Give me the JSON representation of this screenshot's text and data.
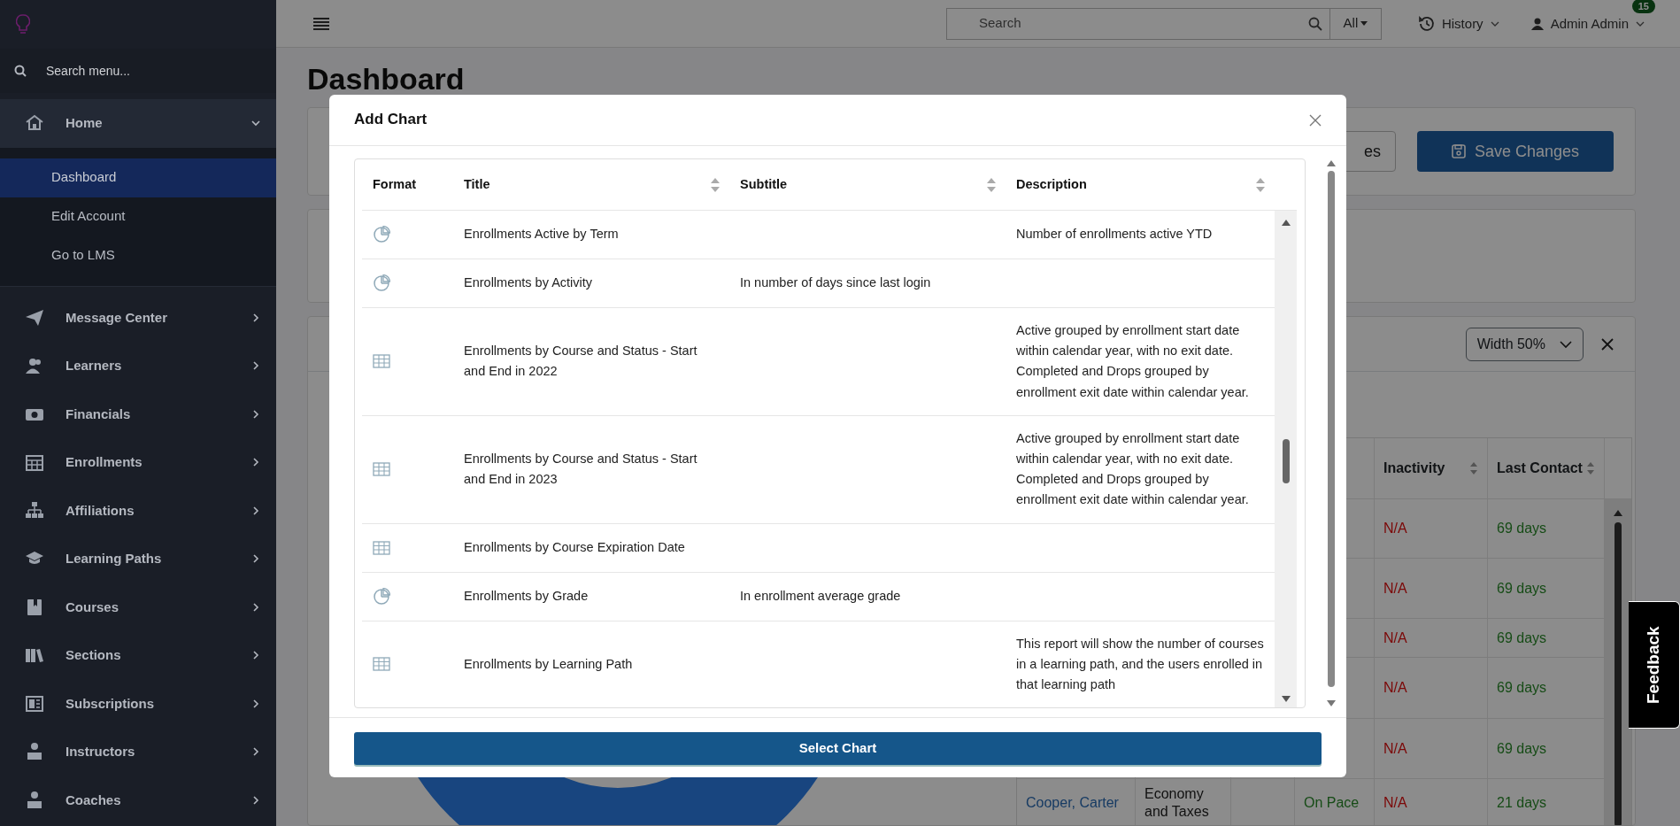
{
  "sidebar": {
    "search": {
      "placeholder": "Search menu..."
    },
    "items": [
      {
        "label": "Home",
        "expanded": true,
        "children": [
          {
            "label": "Dashboard",
            "selected": true
          },
          {
            "label": "Edit Account",
            "selected": false
          },
          {
            "label": "Go to LMS",
            "selected": false
          }
        ]
      },
      {
        "label": "Message Center",
        "expanded": false
      },
      {
        "label": "Learners",
        "expanded": false
      },
      {
        "label": "Financials",
        "expanded": false
      },
      {
        "label": "Enrollments",
        "expanded": false
      },
      {
        "label": "Affiliations",
        "expanded": false
      },
      {
        "label": "Learning Paths",
        "expanded": false
      },
      {
        "label": "Courses",
        "expanded": false
      },
      {
        "label": "Sections",
        "expanded": false
      },
      {
        "label": "Subscriptions",
        "expanded": false
      },
      {
        "label": "Instructors",
        "expanded": false
      },
      {
        "label": "Coaches",
        "expanded": false
      }
    ]
  },
  "topbar": {
    "search": {
      "placeholder": "Search"
    },
    "scope": "All",
    "history": "History",
    "user": "Admin Admin",
    "notification_count": "15"
  },
  "page": {
    "title": "Dashboard",
    "toolbar_buttons": [
      "es",
      "Save Changes"
    ],
    "widget": {
      "width_select": "Width 50%",
      "table": {
        "columns": [
          "Inactivity",
          "Last Contact"
        ],
        "rows": [
          {
            "inactivity": "N/A",
            "last_contact": "69 days"
          },
          {
            "inactivity": "N/A",
            "last_contact": "69 days"
          },
          {
            "inactivity": "N/A",
            "last_contact": "69 days"
          },
          {
            "inactivity": "N/A",
            "last_contact": "69 days"
          },
          {
            "inactivity": "N/A",
            "last_contact": "69 days"
          },
          {
            "column_1": "Cooper, Carter",
            "column_2": "Economy and Taxes",
            "column_4": "On Pace",
            "inactivity": "N/A",
            "last_contact": "21 days"
          }
        ]
      }
    }
  },
  "modal": {
    "title": "Add Chart",
    "columns": [
      {
        "label": "Format",
        "sortable": false
      },
      {
        "label": "Title",
        "sortable": true
      },
      {
        "label": "Subtitle",
        "sortable": true
      },
      {
        "label": "Description",
        "sortable": true
      }
    ],
    "rows": [
      {
        "kind": "pie",
        "title": "Enrollments Active by Term",
        "description": "Number of enrollments active YTD"
      },
      {
        "kind": "pie",
        "title": "Enrollments by Activity",
        "subtitle": "In number of days since last login"
      },
      {
        "kind": "table",
        "title": "Enrollments by Course and Status - Start and End in 2022",
        "description": "Active grouped by enrollment start date within calendar year, with no exit date. Completed and Drops grouped by enrollment exit date within calendar year."
      },
      {
        "kind": "table",
        "title": "Enrollments by Course and Status - Start and End in 2023",
        "description": "Active grouped by enrollment start date within calendar year, with no exit date. Completed and Drops grouped by enrollment exit date within calendar year."
      },
      {
        "kind": "table",
        "title": "Enrollments by Course Expiration Date"
      },
      {
        "kind": "pie",
        "title": "Enrollments by Grade",
        "subtitle": "In enrollment average grade"
      },
      {
        "kind": "table",
        "title": "Enrollments by Learning Path",
        "description": "This report will show the number of courses in a learning path, and the users enrolled in that learning path"
      }
    ],
    "button": "Select Chart"
  },
  "feedback_tab": "Feedback"
}
